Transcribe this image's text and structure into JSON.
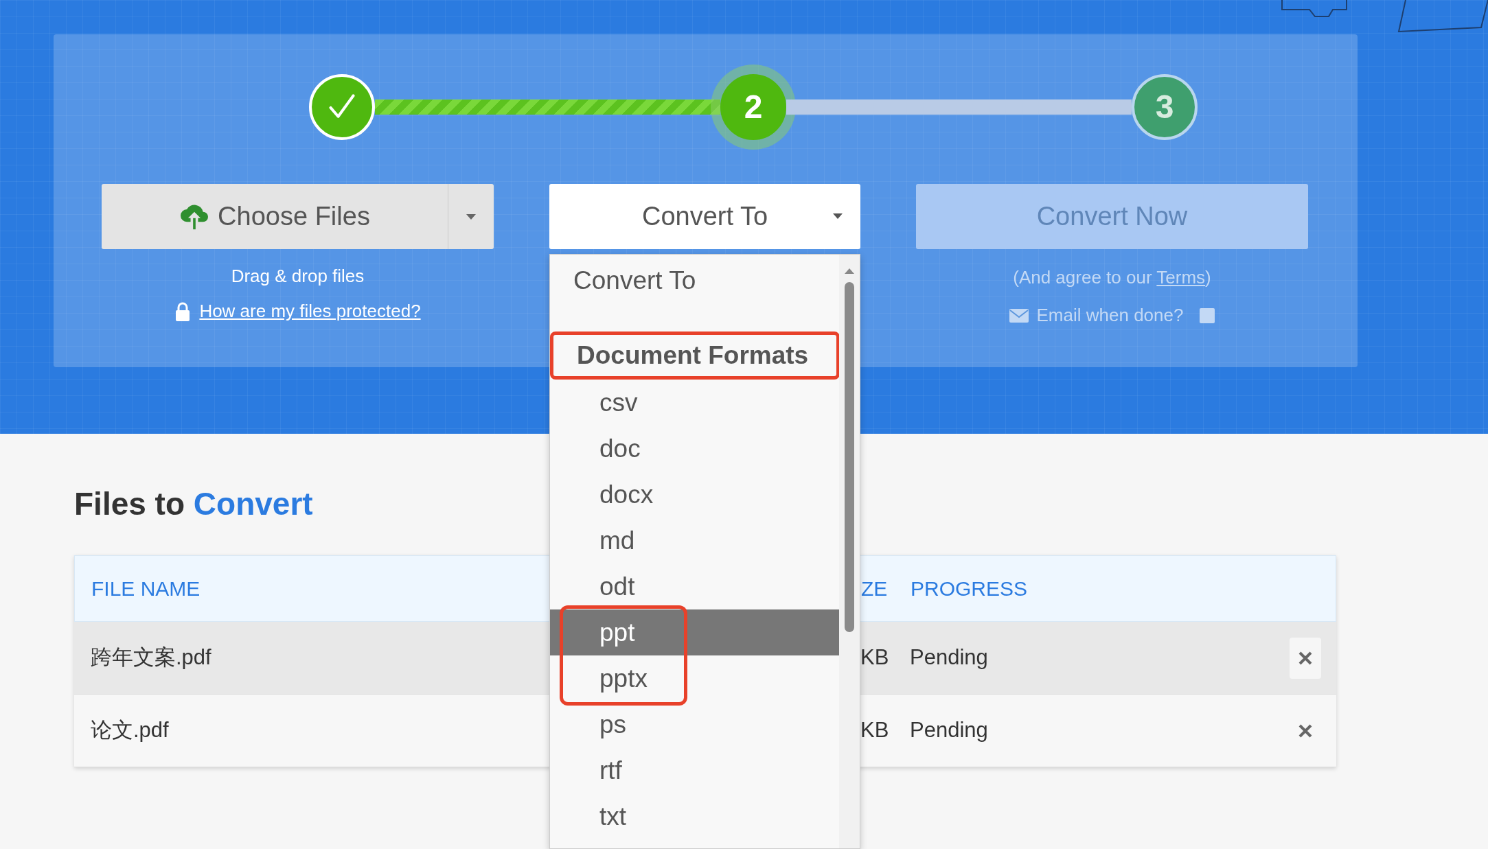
{
  "steps": [
    {
      "kind": "done"
    },
    {
      "kind": "active",
      "label": "2"
    },
    {
      "kind": "pending",
      "label": "3"
    }
  ],
  "choose_files": {
    "label": "Choose Files",
    "hint": "Drag & drop files",
    "protection_link": "How are my files protected?"
  },
  "convert_to": {
    "label": "Convert To"
  },
  "convert_now": {
    "label": "Convert Now",
    "disabled": true,
    "terms_prefix": "(And agree to our ",
    "terms_link": "Terms",
    "terms_suffix": ")",
    "email_label": "Email when done?",
    "email_checked": false
  },
  "dropdown": {
    "placeholder": "Convert To",
    "group": "Document Formats",
    "highlighted": true,
    "options": [
      {
        "label": "csv",
        "selected": false,
        "highlighted": false
      },
      {
        "label": "doc",
        "selected": false,
        "highlighted": false
      },
      {
        "label": "docx",
        "selected": false,
        "highlighted": false
      },
      {
        "label": "md",
        "selected": false,
        "highlighted": false
      },
      {
        "label": "odt",
        "selected": false,
        "highlighted": false
      },
      {
        "label": "ppt",
        "selected": true,
        "highlighted": true
      },
      {
        "label": "pptx",
        "selected": false,
        "highlighted": true
      },
      {
        "label": "ps",
        "selected": false,
        "highlighted": false
      },
      {
        "label": "rtf",
        "selected": false,
        "highlighted": false
      },
      {
        "label": "txt",
        "selected": false,
        "highlighted": false
      }
    ]
  },
  "files_section": {
    "title_prefix": "Files to",
    "title_accent": "Convert"
  },
  "table": {
    "columns": [
      "FILE NAME",
      "ZE",
      "PROGRESS"
    ],
    "rows": [
      {
        "file_name": "跨年文案.pdf",
        "column_2": "KB",
        "progress": "Pending",
        "selected": true
      },
      {
        "file_name": "论文.pdf",
        "column_2": "KB",
        "progress": "Pending",
        "selected": false
      }
    ]
  }
}
